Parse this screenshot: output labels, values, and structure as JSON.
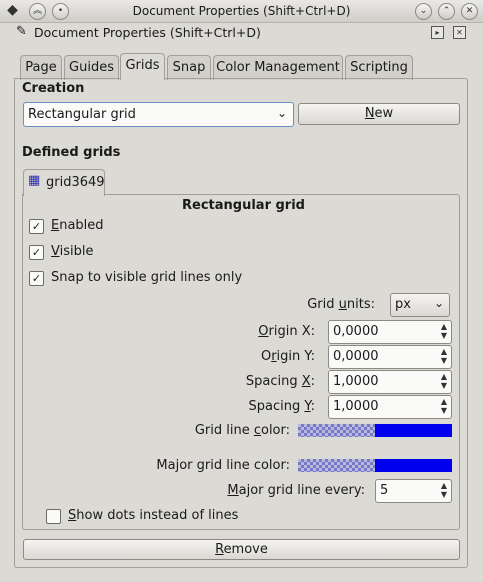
{
  "window": {
    "title": "Document Properties (Shift+Ctrl+D)"
  },
  "dock": {
    "title": "Document Properties (Shift+Ctrl+D)"
  },
  "tabs": [
    "Page",
    "Guides",
    "Grids",
    "Snap",
    "Color Management",
    "Scripting"
  ],
  "active_tab": "Grids",
  "creation": {
    "header": "Creation",
    "grid_type": "Rectangular grid",
    "new_pre": "",
    "new_u": "N",
    "new_post": "ew"
  },
  "defined": {
    "header": "Defined grids",
    "grid_tab": "grid3649",
    "grid_title": "Rectangular grid"
  },
  "options": {
    "enabled": {
      "u": "E",
      "rest": "nabled",
      "checked": true
    },
    "visible": {
      "u": "V",
      "rest": "isible",
      "checked": true
    },
    "snap": {
      "label": "Snap to visible grid lines only",
      "checked": true
    },
    "dots": {
      "u": "S",
      "rest": "how dots instead of lines",
      "checked": false
    }
  },
  "fields": {
    "units_pre": "Grid ",
    "units_u": "u",
    "units_post": "nits:",
    "units_value": "px",
    "origin_x_u": "O",
    "origin_x_post": "rigin X:",
    "origin_x": "0,0000",
    "origin_y_pre": "O",
    "origin_y_u": "r",
    "origin_y_post": "igin Y:",
    "origin_y": "0,0000",
    "spacing_x_pre": "Spacing ",
    "spacing_x_u": "X",
    "spacing_x_post": ":",
    "spacing_x": "1,0000",
    "spacing_y_pre": "Spacing ",
    "spacing_y_u": "Y",
    "spacing_y_post": ":",
    "spacing_y": "1,0000",
    "line_color_pre": "Grid line ",
    "line_color_u": "c",
    "line_color_post": "olor:",
    "major_color_label": "Major grid line color:",
    "major_every_u": "M",
    "major_every_post": "ajor grid line every:",
    "major_every": "5"
  },
  "colors": {
    "grid_line": "#0000ee",
    "major_line": "#0000ee"
  },
  "remove": {
    "u": "R",
    "rest": "emove"
  }
}
